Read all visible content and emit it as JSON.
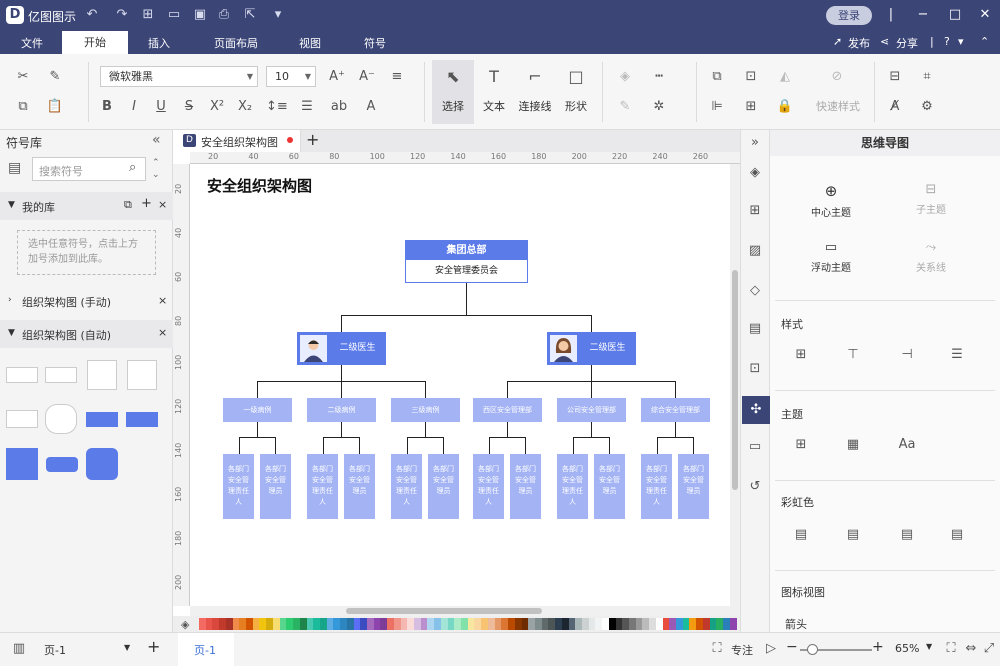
{
  "app": {
    "title": "亿图图示",
    "logo": "D",
    "login_label": "登录"
  },
  "menubar": {
    "tabs": [
      "文件",
      "开始",
      "插入",
      "页面布局",
      "视图",
      "符号"
    ],
    "active": "开始",
    "publish": "发布",
    "share": "分享"
  },
  "ribbon": {
    "font_name": "微软雅黑",
    "font_size": "10",
    "tools": {
      "select": "选择",
      "text": "文本",
      "connector": "连接线",
      "shape": "形状"
    },
    "quick_style": "快速样式"
  },
  "left_panel": {
    "title": "符号库",
    "search_placeholder": "搜索符号",
    "my_library": "我的库",
    "my_library_hint": "选中任意符号，点击上方加号添加到此库。",
    "lib_manual": "组织架构图 (手动)",
    "lib_auto": "组织架构图 (自动)"
  },
  "canvas": {
    "tab_name": "安全组织架构图",
    "ruler_h": [
      "20",
      "40",
      "60",
      "80",
      "100",
      "120",
      "140",
      "160",
      "180",
      "200",
      "220",
      "240",
      "260"
    ],
    "ruler_v": [
      "20",
      "40",
      "60",
      "80",
      "100",
      "120",
      "140",
      "160",
      "180",
      "200"
    ],
    "diagram_title": "安全组织架构图",
    "root_title": "集团总部",
    "root_sub": "安全管理委员会",
    "level2": [
      "二级医生",
      "二级医生"
    ],
    "level3": [
      "一级病例",
      "二级病例",
      "三级病例",
      "西区安全管理部",
      "公司安全管理部",
      "综合安全管理部"
    ],
    "leaf_a": "各部门安全管理责任人",
    "leaf_b": "各部门安全管理员"
  },
  "right_panel": {
    "title": "思维导图",
    "center_topic": "中心主题",
    "sub_topic": "子主题",
    "float_topic": "浮动主题",
    "relation": "关系线",
    "style": "样式",
    "theme": "主题",
    "rainbow": "彩虹色",
    "icon_view": "图标视图",
    "arrow": "箭头"
  },
  "status": {
    "page_select": "页-1",
    "page_tab": "页-1",
    "focus": "专注",
    "zoom": "65%"
  },
  "palette": [
    "#f26a62",
    "#e8534a",
    "#d9473d",
    "#c0392b",
    "#a93226",
    "#f08a4b",
    "#e67e22",
    "#d35400",
    "#f5b041",
    "#f1c40f",
    "#d4ac0d",
    "#f7dc6f",
    "#58d68d",
    "#2ecc71",
    "#28b463",
    "#1e8449",
    "#48c9b0",
    "#1abc9c",
    "#17a589",
    "#5dade2",
    "#3498db",
    "#2e86c1",
    "#2874a6",
    "#5b6ef5",
    "#3b4cc0",
    "#a569bd",
    "#8e44ad",
    "#7d3c98",
    "#ec7063",
    "#f1948a",
    "#f5b7b1",
    "#fadbd8",
    "#d7bde2",
    "#bb8fce",
    "#aed6f1",
    "#85c1e9",
    "#a3e4d7",
    "#76d7c4",
    "#abebc6",
    "#82e0aa",
    "#f9e79f",
    "#fad7a0",
    "#f8c471",
    "#edbb99",
    "#e59866",
    "#dc7633",
    "#ba4a00",
    "#873600",
    "#6e2c00",
    "#99a3a4",
    "#7f8c8d",
    "#616a6b",
    "#4d5656",
    "#2c3e50",
    "#1b2631",
    "#566573",
    "#aab7b8",
    "#ccd1d1",
    "#e5e8e8",
    "#f2f3f4",
    "#fdfefe",
    "#000000",
    "#333333",
    "#555555",
    "#777777",
    "#999999",
    "#bbbbbb",
    "#dddddd",
    "#ffffff",
    "#e74c3c",
    "#9b59b6",
    "#3498db",
    "#1abc9c",
    "#f39c12",
    "#d35400",
    "#c0392b",
    "#16a085",
    "#27ae60",
    "#2980b9",
    "#8e44ad"
  ],
  "colors": {
    "title_bar": "#3b4576",
    "node": "#a3b3f4",
    "node_dark": "#5b7be9",
    "root": "#5b7be9"
  }
}
